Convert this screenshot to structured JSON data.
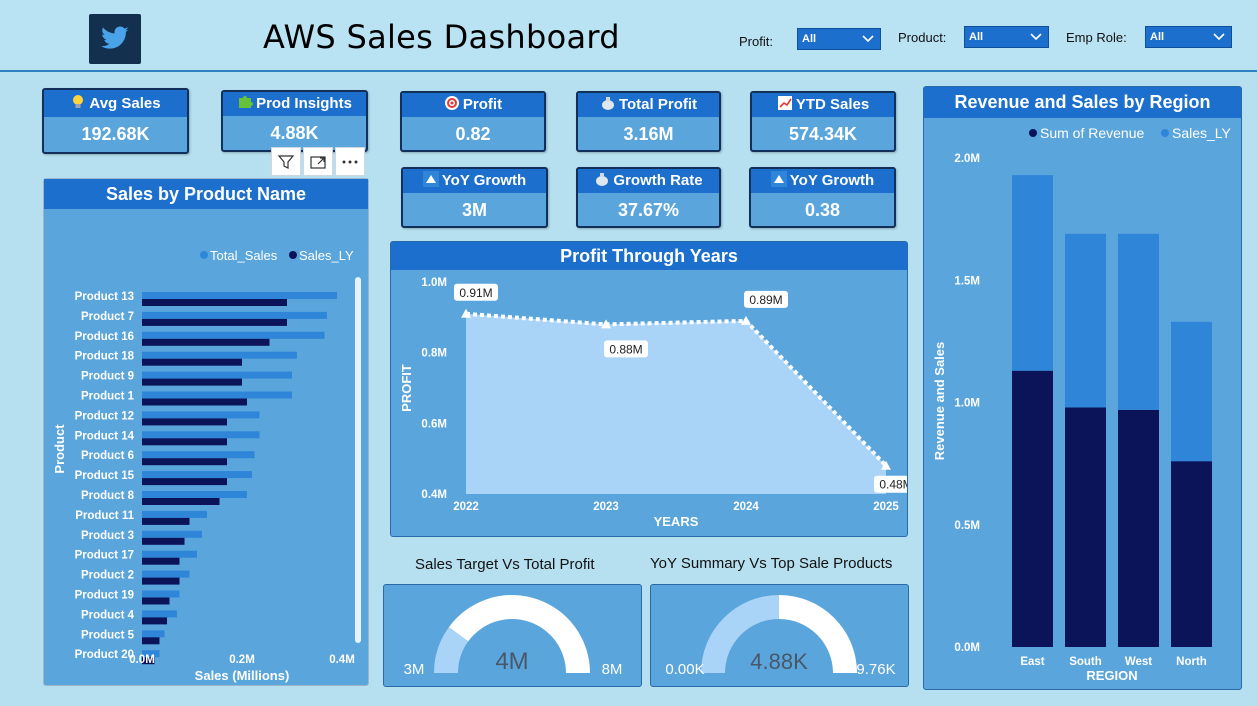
{
  "header": {
    "title": "AWS Sales Dashboard",
    "logo_icon": "twitter-bird-icon",
    "slicers": [
      {
        "label": "Profit:",
        "value": "All"
      },
      {
        "label": "Product:",
        "value": "All"
      },
      {
        "label": "Emp Role:",
        "value": "All"
      }
    ]
  },
  "kpis": [
    {
      "title": "Avg Sales",
      "value": "192.68K",
      "icon": "lightbulb-icon"
    },
    {
      "title": "Prod Insights",
      "value": "4.88K",
      "icon": "puzzle-icon"
    },
    {
      "title": "Profit",
      "value": "0.82",
      "icon": "target-icon"
    },
    {
      "title": "Total Profit",
      "value": "3.16M",
      "icon": "money-bag-icon"
    },
    {
      "title": "YTD Sales",
      "value": "574.34K",
      "icon": "chart-increasing-icon"
    },
    {
      "title": "YoY Growth",
      "value": "3M",
      "icon": "up-triangle-icon"
    },
    {
      "title": "Growth Rate",
      "value": "37.67%",
      "icon": "money-bag-icon"
    },
    {
      "title": "YoY Growth",
      "value": "0.38",
      "icon": "up-triangle-icon"
    }
  ],
  "colors": {
    "accent": "#1c6fcc",
    "panel": "#5aa5dc",
    "dark_series": "#0b1359",
    "light_series": "#2f86d8",
    "area_fill": "#a9d3f7"
  },
  "chart_data": [
    {
      "type": "bar",
      "title": "Sales by Product Name",
      "xlabel": "Sales (Millions)",
      "ylabel": "Product",
      "orientation": "horizontal",
      "legend": "top-right",
      "categories": [
        "Product 13",
        "Product 7",
        "Product 16",
        "Product 18",
        "Product 9",
        "Product 1",
        "Product 12",
        "Product 14",
        "Product 6",
        "Product 15",
        "Product 8",
        "Product 11",
        "Product 3",
        "Product 17",
        "Product 2",
        "Product 19",
        "Product 4",
        "Product 5",
        "Product 20"
      ],
      "series": [
        {
          "name": "Total_Sales",
          "values": [
            0.39,
            0.37,
            0.365,
            0.31,
            0.3,
            0.3,
            0.235,
            0.235,
            0.225,
            0.22,
            0.21,
            0.13,
            0.12,
            0.11,
            0.095,
            0.075,
            0.07,
            0.045,
            0.035
          ]
        },
        {
          "name": "Sales_LY",
          "values": [
            0.29,
            0.29,
            0.255,
            0.2,
            0.2,
            0.21,
            0.17,
            0.17,
            0.17,
            0.17,
            0.155,
            0.095,
            0.085,
            0.075,
            0.075,
            0.055,
            0.05,
            0.035,
            0.025
          ]
        }
      ],
      "xticks": [
        "0.0M",
        "0.2M",
        "0.4M"
      ],
      "xlim": [
        0,
        0.4
      ]
    },
    {
      "type": "area",
      "title": "Profit Through Years",
      "xlabel": "YEARS",
      "ylabel": "PROFIT",
      "x": [
        "2022",
        "2023",
        "2024",
        "2025"
      ],
      "values": [
        0.91,
        0.88,
        0.89,
        0.48
      ],
      "data_labels": [
        "0.91M",
        "0.88M",
        "0.89M",
        "0.48M"
      ],
      "yticks": [
        "0.4M",
        "0.6M",
        "0.8M",
        "1.0M"
      ],
      "ylim": [
        0.4,
        1.0
      ]
    },
    {
      "type": "bar",
      "title": "Revenue and Sales by Region",
      "stacked": true,
      "xlabel": "REGION",
      "ylabel": "Revenue and Sales",
      "legend": "top-right",
      "categories": [
        "East",
        "South",
        "West",
        "North"
      ],
      "series": [
        {
          "name": "Sum of Revenue",
          "values": [
            1.13,
            0.98,
            0.97,
            0.76
          ]
        },
        {
          "name": "Sales_LY",
          "values": [
            0.8,
            0.71,
            0.72,
            0.57
          ]
        }
      ],
      "yticks": [
        "0.0M",
        "0.5M",
        "1.0M",
        "1.5M",
        "2.0M"
      ],
      "ylim": [
        0,
        2.0
      ]
    },
    {
      "type": "gauge",
      "title": "Sales Target Vs Total Profit",
      "value": 4,
      "min": 3,
      "max": 8,
      "fill_fraction": 0.2,
      "value_label": "4M",
      "min_label": "3M",
      "max_label": "8M"
    },
    {
      "type": "gauge",
      "title": "YoY Summary Vs Top Sale Products",
      "value": 4.88,
      "min": 0,
      "max": 9.76,
      "fill_fraction": 0.5,
      "value_label": "4.88K",
      "min_label": "0.00K",
      "max_label": "9.76K"
    }
  ]
}
